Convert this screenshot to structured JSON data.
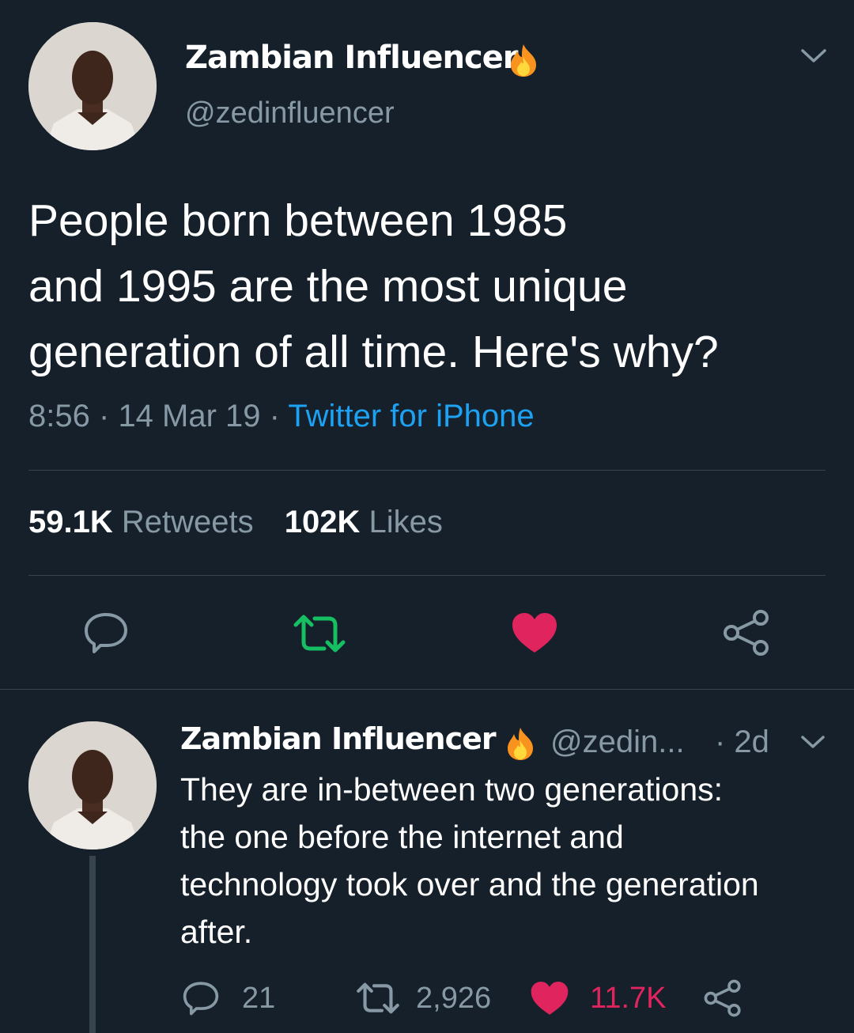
{
  "main_tweet": {
    "display_name": "Zambian Influencer",
    "handle": "@zedinfluencer",
    "text_lines": [
      "People born between 1985",
      "and 1995 are the most unique",
      "generation of all time. Here's why?"
    ],
    "time": "8:56",
    "date": "14 Mar 19",
    "source": "Twitter for iPhone",
    "separator": "·",
    "retweet_count": "59.1K",
    "retweet_label": "Retweets",
    "like_count": "102K",
    "like_label": "Likes"
  },
  "reply": {
    "display_name": "Zambian Influencer",
    "handle": "@zedin...",
    "age": "· 2d",
    "text_lines": [
      "They are in-between two generations:",
      "the one before the internet and",
      "technology took over and the generation",
      "after."
    ],
    "reply_count": "21",
    "retweet_count": "2,926",
    "like_count": "11.7K"
  },
  "colors": {
    "background": "#15202b",
    "muted": "#8899a6",
    "link": "#1da1f2",
    "retweet_active": "#17bf63",
    "like_active": "#e0245e"
  },
  "icons": {
    "verified_emoji": "fire-icon",
    "more": "chevron-down-icon",
    "reply": "speech-bubble-icon",
    "retweet": "retweet-icon",
    "like": "heart-icon",
    "share": "share-icon"
  }
}
